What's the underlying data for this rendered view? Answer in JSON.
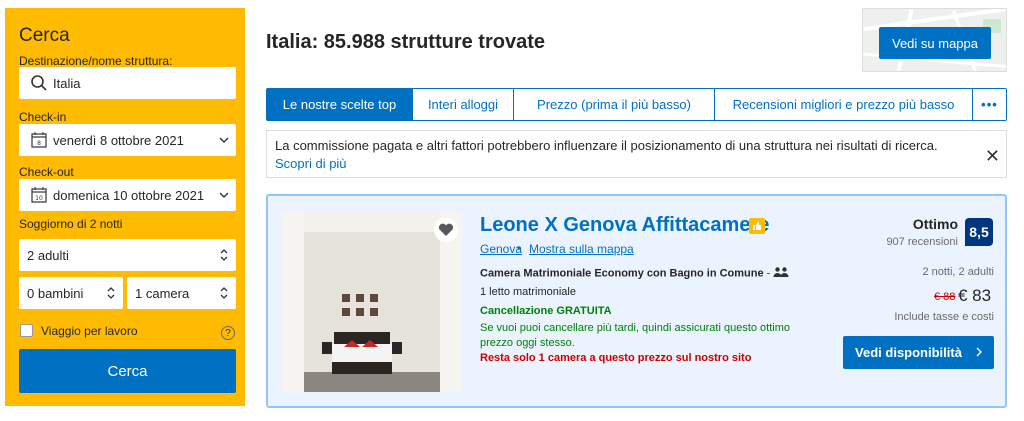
{
  "search": {
    "title": "Cerca",
    "destination_label": "Destinazione/nome struttura:",
    "destination_value": "Italia",
    "checkin_label": "Check-in",
    "checkin_value": "venerdì 8 ottobre 2021",
    "checkin_icon_day": "8",
    "checkout_label": "Check-out",
    "checkout_value": "domenica 10 ottobre 2021",
    "checkout_icon_day": "10",
    "stay_label": "Soggiorno di 2 notti",
    "adults_value": "2 adulti",
    "children_value": "0 bambini",
    "rooms_value": "1 camera",
    "business_trip_label": "Viaggio per lavoro",
    "help_glyph": "?",
    "submit_label": "Cerca"
  },
  "header": {
    "title": "Italia: 85.988 strutture trovate",
    "map_button_label": "Vedi su mappa"
  },
  "sort_tabs": [
    {
      "label": "Le nostre scelte top",
      "active": true
    },
    {
      "label": "Interi alloggi",
      "active": false
    },
    {
      "label": "Prezzo (prima il più basso)",
      "active": false
    },
    {
      "label": "Recensioni migliori e prezzo più basso",
      "active": false
    },
    {
      "label": "•••",
      "active": false
    }
  ],
  "notice": {
    "text": "La commissione pagata e altri fattori potrebbero influenzare il posizionamento di una struttura nei risultati di ricerca.",
    "link_text": "Scopri di più",
    "close_glyph": "✕"
  },
  "property": {
    "name": "Leone X Genova Affittacamere",
    "city": "Genova",
    "map_link": "Mostra sulla mappa",
    "room_type": "Camera Matrimoniale Economy con Bagno in Comune",
    "beds": "1 letto matrimoniale",
    "cancellation": "Cancellazione GRATUITA",
    "cancellation_note": "Se vuoi puoi cancellare più tardi, quindi assicurati questo ottimo prezzo oggi stesso.",
    "scarcity": "Resta solo 1 camera a questo prezzo sul nostro sito",
    "rating_word": "Ottimo",
    "review_count": "907 recensioni",
    "score": "8,5",
    "stay_summary": "2 notti, 2 adulti",
    "old_price": "€ 88",
    "price": "€ 83",
    "taxes_note": "Include tasse e costi",
    "cta_label": "Vedi disponibilità"
  },
  "colors": {
    "brand_yellow": "#febb02",
    "brand_blue": "#0071c2",
    "dark_blue": "#003580",
    "green": "#008009",
    "red": "#cc0000"
  }
}
